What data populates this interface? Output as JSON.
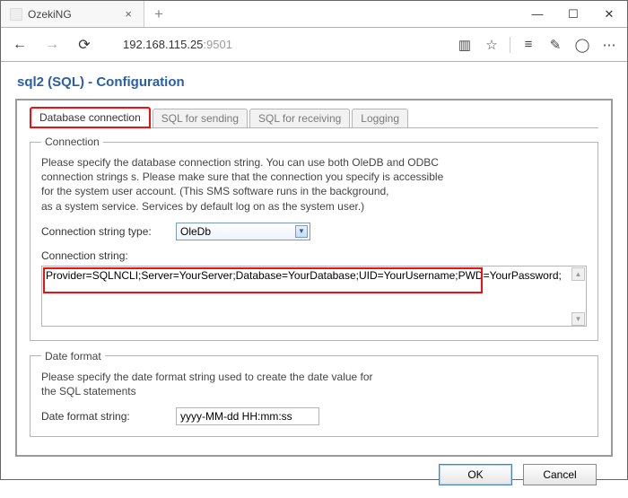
{
  "browser": {
    "tab_title": "OzekiNG",
    "url_host": "192.168.115.25",
    "url_port": ":9501"
  },
  "page": {
    "title": "sql2 (SQL) - Configuration"
  },
  "tabs": {
    "db_connection": "Database connection",
    "sql_sending": "SQL for sending",
    "sql_receiving": "SQL for receiving",
    "logging": "Logging"
  },
  "connection": {
    "legend": "Connection",
    "desc_l1": "Please specify the database connection string. You can use both OleDB and ODBC",
    "desc_l2": "connection strings s. Please make sure that the connection you specify is accessible",
    "desc_l3": "for the system user account. (This SMS software runs in the background,",
    "desc_l4": "as a system service. Services by default log on as the system user.)",
    "type_label": "Connection string type:",
    "type_value": "OleDb",
    "string_label": "Connection string:",
    "string_value": "Provider=SQLNCLI;Server=YourServer;Database=YourDatabase;UID=YourUsername;PWD=YourPassword;"
  },
  "dateformat": {
    "legend": "Date format",
    "desc_l1": "Please specify the date format string used to create the date value for",
    "desc_l2": "the SQL statements",
    "label": "Date format string:",
    "value": "yyyy-MM-dd HH:mm:ss"
  },
  "buttons": {
    "ok": "OK",
    "cancel": "Cancel"
  }
}
